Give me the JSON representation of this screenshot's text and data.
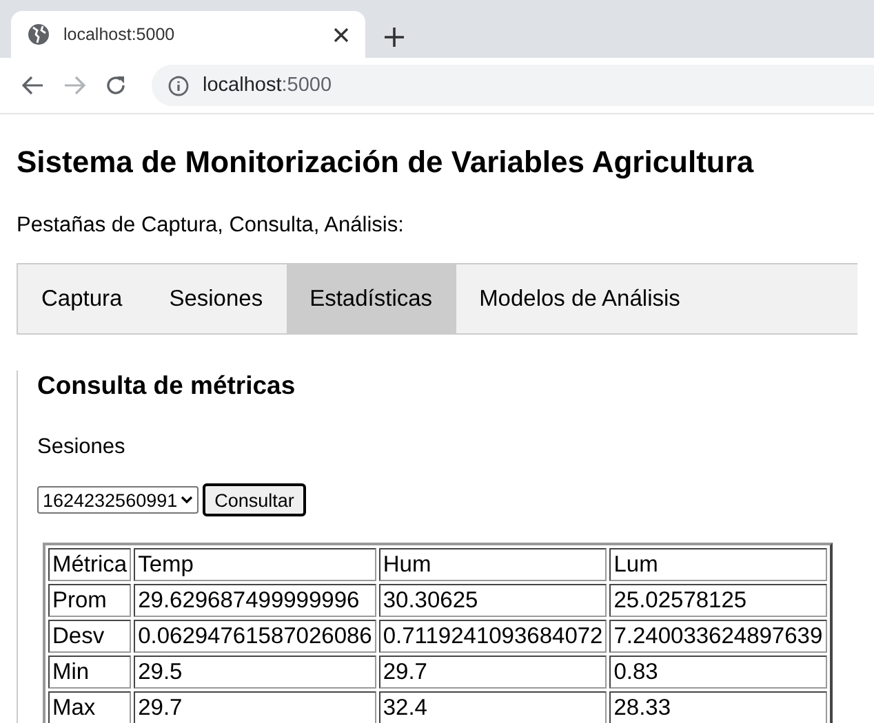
{
  "browser": {
    "tab_title": "localhost:5000",
    "url_host": "localhost",
    "url_port": ":5000",
    "forward_disabled": true
  },
  "title": "Sistema de Monitorización de Variables Agricultura",
  "subtitle": "Pestañas de Captura, Consulta, Análisis:",
  "tabs": [
    {
      "label": "Captura",
      "selected": false
    },
    {
      "label": "Sesiones",
      "selected": false
    },
    {
      "label": "Estadísticas",
      "selected": true
    },
    {
      "label": "Modelos de Análisis",
      "selected": false
    }
  ],
  "panel": {
    "heading": "Consulta de métricas",
    "sessions_label": "Sesiones",
    "session_select": "1624232560991",
    "button": "Consultar"
  },
  "table": {
    "columns": [
      "Métrica",
      "Temp",
      "Hum",
      "Lum"
    ],
    "rows": [
      [
        "Prom",
        "29.629687499999996",
        "30.30625",
        "25.02578125"
      ],
      [
        "Desv",
        "0.06294761587026086",
        "0.7119241093684072",
        "7.240033624897639"
      ],
      [
        "Min",
        "29.5",
        "29.7",
        "0.83"
      ],
      [
        "Max",
        "29.7",
        "32.4",
        "28.33"
      ]
    ]
  }
}
